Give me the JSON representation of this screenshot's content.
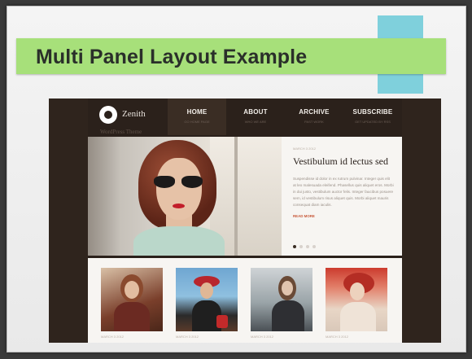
{
  "slide": {
    "title": "Multi Panel Layout Example"
  },
  "site": {
    "brand": "Zenith",
    "tagline": "WordPress Theme",
    "nav": [
      {
        "label": "HOME",
        "sub": "GO HOME PAGE",
        "active": true
      },
      {
        "label": "ABOUT",
        "sub": "WHO WE ARE",
        "active": false
      },
      {
        "label": "ARCHIVE",
        "sub": "PAST WORK",
        "active": false
      },
      {
        "label": "SUBSCRIBE",
        "sub": "GET UPDATED BY RSS",
        "active": false
      }
    ],
    "hero": {
      "meta": "MARCH 3 2012",
      "title": "Vestibulum id lectus sed",
      "body": "Suspendisse id dolor in ex rutrum pulvinar. Integer quis elit at leo malesuada eleifend. Phasellus quis aliquet eros. Morbi in dui justo, vestibulum auctor felis. Integer faucibus posuere sem, id vestibulum risus aliquet quis. Morbi aliquet mauris consequat diam iaculis.",
      "read_more": "READ MORE",
      "slides_total": 4,
      "slide_active": 1
    },
    "cards": [
      {
        "meta": "MARCH 3 2012"
      },
      {
        "meta": "MARCH 3 2012"
      },
      {
        "meta": "MARCH 3 2012"
      },
      {
        "meta": "MARCH 3 2012"
      }
    ]
  },
  "colors": {
    "title_bar": "#a7e07a",
    "accent_tab": "#7fd0dc",
    "site_bg": "#2b211b",
    "read_more": "#c8593a"
  }
}
